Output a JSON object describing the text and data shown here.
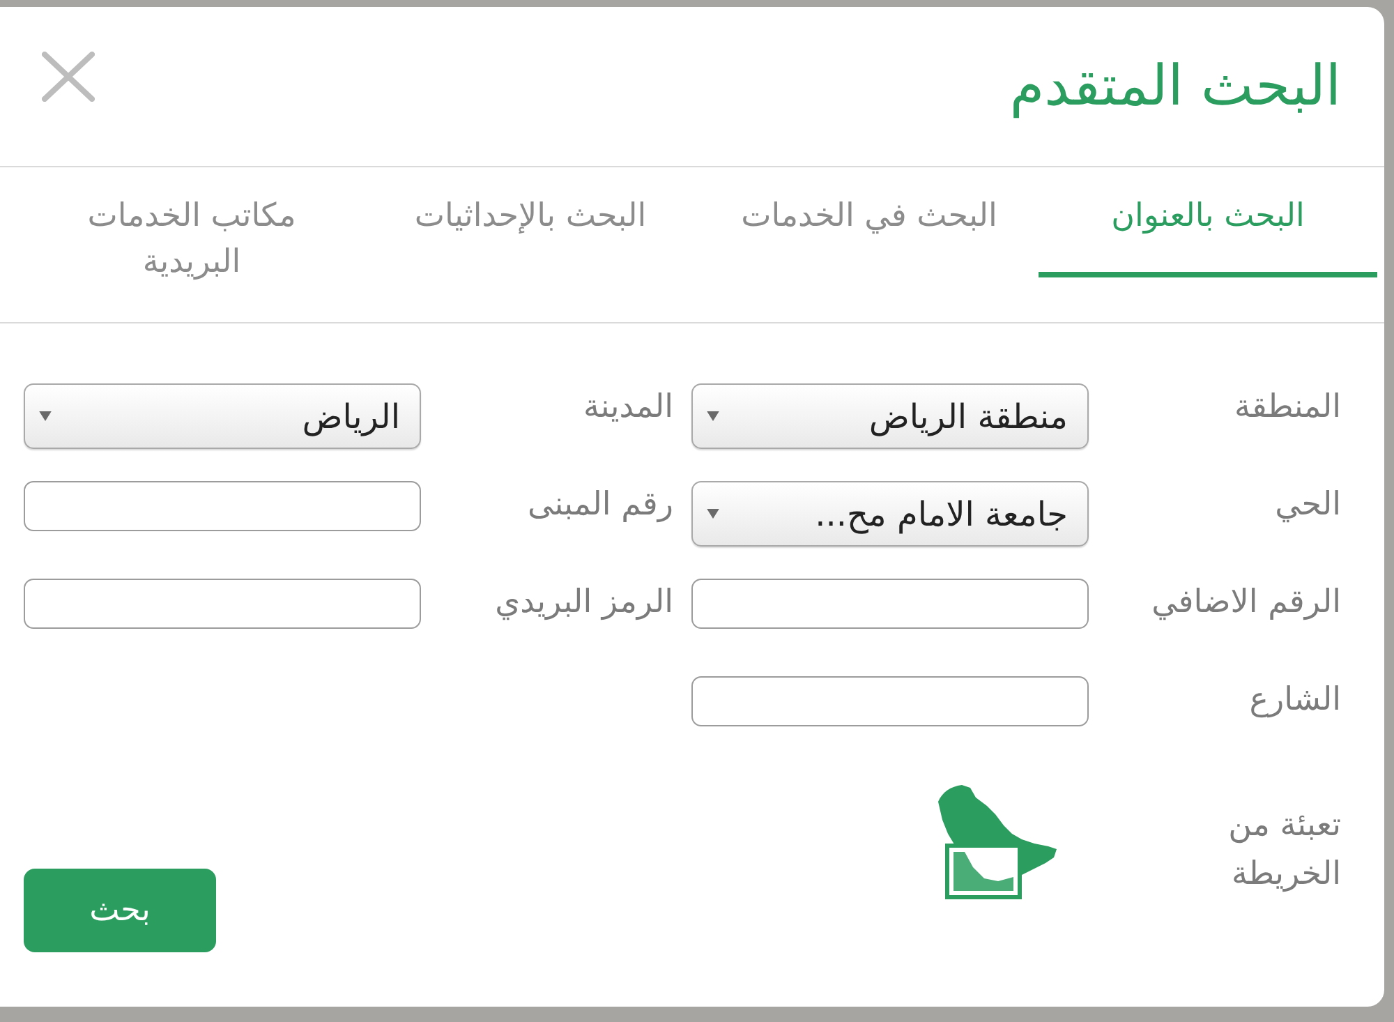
{
  "dialog": {
    "title": "البحث المتقدم"
  },
  "tabs": [
    {
      "label": "البحث بالعنوان",
      "selected": true
    },
    {
      "label": "البحث في الخدمات",
      "selected": false
    },
    {
      "label": "البحث بالإحداثيات",
      "selected": false
    },
    {
      "label": "مكاتب الخدمات البريدية",
      "selected": false
    }
  ],
  "form": {
    "rows": [
      [
        {
          "label": "المنطقة",
          "kind": "select",
          "value": "منطقة الرياض"
        },
        {
          "label": "المدينة",
          "kind": "select",
          "value": "الرياض"
        }
      ],
      [
        {
          "label": "الحي",
          "kind": "select",
          "value": "جامعة الامام مح..."
        },
        {
          "label": "رقم المبنى",
          "kind": "input"
        }
      ],
      [
        {
          "label": "الرقم الاضافي",
          "kind": "input"
        },
        {
          "label": "الرمز البريدي",
          "kind": "input"
        }
      ],
      [
        {
          "label": "الشارع",
          "kind": "input"
        }
      ]
    ]
  },
  "map_fill": {
    "label": "تعبئة من الخريطة"
  },
  "search_button": {
    "label": "بحث"
  }
}
